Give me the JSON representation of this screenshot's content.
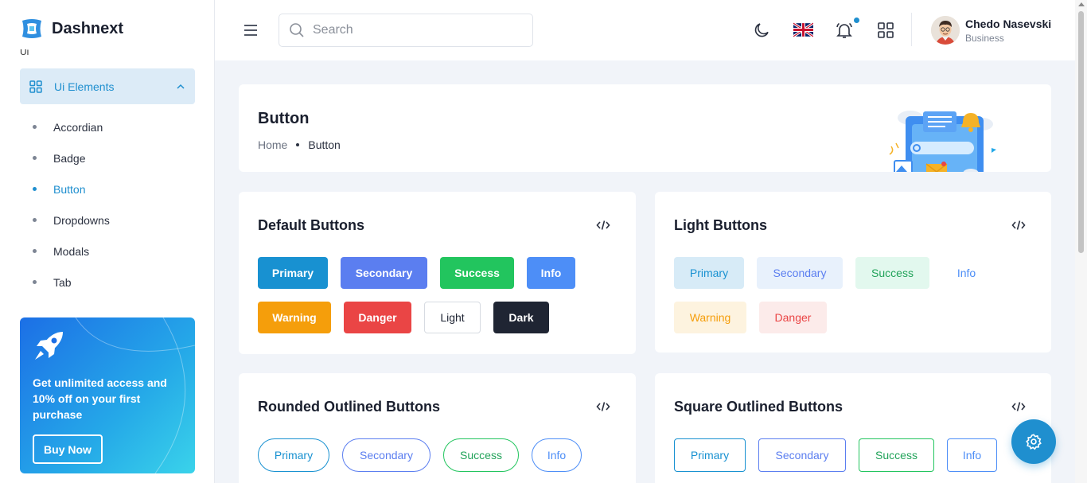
{
  "brand": {
    "name": "Dashnext",
    "partial_text": "Ui"
  },
  "sidebar": {
    "group_label": "Ui Elements",
    "items": [
      {
        "label": "Accordian",
        "active": false
      },
      {
        "label": "Badge",
        "active": false
      },
      {
        "label": "Button",
        "active": true
      },
      {
        "label": "Dropdowns",
        "active": false
      },
      {
        "label": "Modals",
        "active": false
      },
      {
        "label": "Tab",
        "active": false
      }
    ],
    "promo": {
      "text": "Get unlimited access and 10% off on your first purchase",
      "button": "Buy Now"
    }
  },
  "header": {
    "search_placeholder": "Search",
    "user": {
      "name": "Chedo Nasevski",
      "role": "Business"
    },
    "icons": [
      "menu-icon",
      "moon-icon",
      "uk-flag-icon",
      "bell-icon",
      "apps-grid-icon"
    ]
  },
  "page": {
    "title": "Button",
    "breadcrumb": [
      "Home",
      "Button"
    ]
  },
  "cards": {
    "default": {
      "title": "Default Buttons",
      "buttons": [
        "Primary",
        "Secondary",
        "Success",
        "Info",
        "Warning",
        "Danger",
        "Light",
        "Dark"
      ]
    },
    "light": {
      "title": "Light Buttons",
      "buttons": [
        "Primary",
        "Secondary",
        "Success",
        "Info",
        "Warning",
        "Danger"
      ]
    },
    "rounded": {
      "title": "Rounded Outlined Buttons",
      "buttons": [
        "Primary",
        "Secondary",
        "Success",
        "Info"
      ]
    },
    "square": {
      "title": "Square Outlined Buttons",
      "buttons": [
        "Primary",
        "Secondary",
        "Success",
        "Info"
      ]
    }
  },
  "colors": {
    "primary": "#1891d1",
    "secondary": "#5b7ef0",
    "success": "#22c55e",
    "info": "#4d8ef7",
    "warning": "#f59e0b",
    "danger": "#ea4545",
    "dark": "#1f2533"
  }
}
